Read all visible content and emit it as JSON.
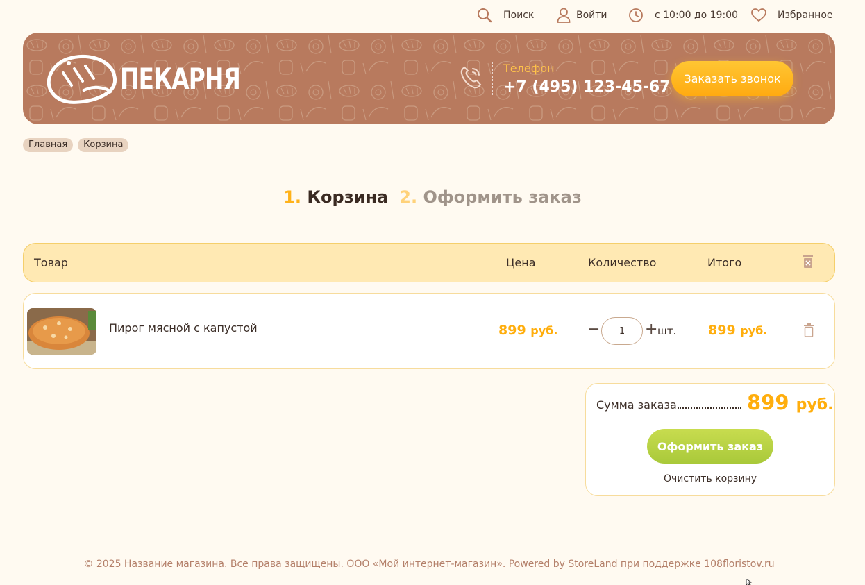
{
  "topbar": {
    "search_label": "Поиск",
    "login_label": "Войти",
    "hours_label": "с 10:00 до 19:00",
    "favorites_label": "Избранное"
  },
  "header": {
    "logo_text": "ПЕКАРНЯ",
    "phone_label": "Телефон",
    "phone_number": "+7 (495) 123-45-67",
    "callback_label": "Заказать звонок"
  },
  "breadcrumb": [
    "Главная",
    "Корзина"
  ],
  "steps": [
    {
      "num": "1.",
      "label": "Корзина",
      "active": true
    },
    {
      "num": "2.",
      "label": "Оформить заказ",
      "active": false
    }
  ],
  "table": {
    "col_product": "Товар",
    "col_price": "Цена",
    "col_quantity": "Количество",
    "col_total": "Итого"
  },
  "items": [
    {
      "name": "Пирог мясной с капустой",
      "price": "899",
      "currency": "руб.",
      "quantity": "1",
      "unit": "шт.",
      "total": "899"
    }
  ],
  "summary": {
    "label": "Сумма заказа",
    "value": "899",
    "currency": "руб.",
    "checkout_label": "Оформить заказ",
    "clear_label": "Очистить корзину"
  },
  "footer": {
    "copyright": "© 2025 Название магазина. Все права защищены. ООО «Мой интернет-магазин». Powered by StoreLand при поддержке 108floristov.ru"
  },
  "colors": {
    "accent": "#ffae0d",
    "banner": "#b87a5e",
    "checkout": "#a9c93a",
    "background": "#fffaf1"
  },
  "icons": [
    "search-icon",
    "user-icon",
    "clock-icon",
    "heart-icon",
    "bread-logo-icon",
    "phone-icon",
    "trash-icon",
    "clear-all-icon"
  ]
}
